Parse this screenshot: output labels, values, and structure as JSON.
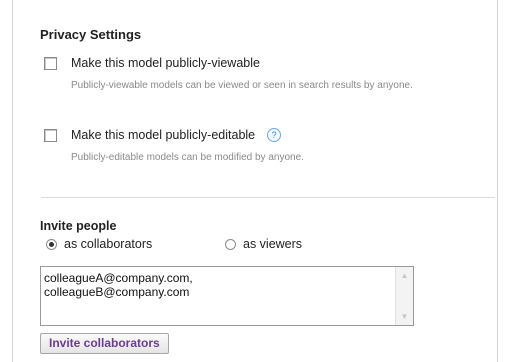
{
  "privacy": {
    "title": "Privacy Settings",
    "options": [
      {
        "label": "Make this model publicly-viewable",
        "description": "Publicly-viewable models can be viewed or seen in search results by anyone.",
        "checked": false
      },
      {
        "label": "Make this model publicly-editable",
        "description": "Publicly-editable models can be modified by anyone.",
        "checked": false,
        "help_icon": "?"
      }
    ]
  },
  "invite": {
    "title": "Invite people",
    "radios": [
      {
        "label": "as collaborators",
        "selected": true
      },
      {
        "label": "as viewers",
        "selected": false
      }
    ],
    "textarea_value": "colleagueA@company.com,\ncolleagueB@company.com",
    "button_label": "Invite collaborators"
  }
}
